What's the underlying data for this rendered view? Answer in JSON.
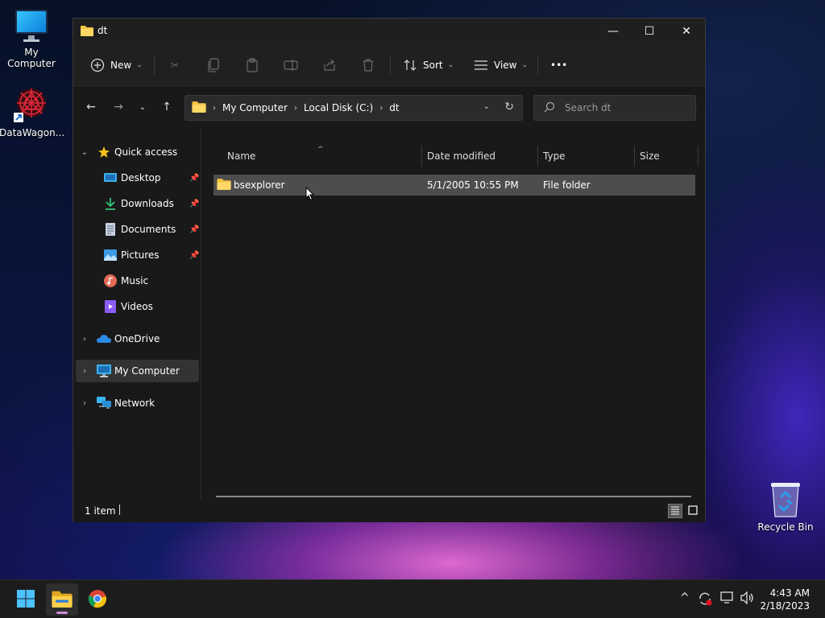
{
  "desktop": {
    "icons": [
      {
        "label": "My Computer"
      },
      {
        "label": "DataWagon..."
      },
      {
        "label": "Recycle Bin"
      }
    ]
  },
  "window": {
    "title": "dt",
    "controls": {
      "minimize": "—",
      "maximize": "☐",
      "close": "✕"
    }
  },
  "toolbar": {
    "new_label": "New",
    "sort_label": "Sort",
    "view_label": "View",
    "more_label": "•••"
  },
  "address": {
    "crumbs": [
      "My Computer",
      "Local Disk (C:)",
      "dt"
    ]
  },
  "search": {
    "placeholder": "Search dt"
  },
  "navpane": {
    "quick_access": "Quick access",
    "items": [
      {
        "label": "Desktop",
        "pinned": true
      },
      {
        "label": "Downloads",
        "pinned": true
      },
      {
        "label": "Documents",
        "pinned": true
      },
      {
        "label": "Pictures",
        "pinned": true
      },
      {
        "label": "Music",
        "pinned": false
      },
      {
        "label": "Videos",
        "pinned": false
      }
    ],
    "onedrive": "OneDrive",
    "mycomputer": "My Computer",
    "network": "Network"
  },
  "content": {
    "columns": {
      "name": "Name",
      "date": "Date modified",
      "type": "Type",
      "size": "Size"
    },
    "rows": [
      {
        "name": "bsexplorer",
        "date": "5/1/2005 10:55 PM",
        "type": "File folder",
        "size": ""
      }
    ]
  },
  "statusbar": {
    "count": "1 item"
  },
  "taskbar": {
    "clock_time": "4:43 AM",
    "clock_date": "2/18/2023"
  },
  "colors": {
    "folder": "#f4c542",
    "accent": "#60cdff",
    "window_bg": "#191919",
    "selection": "#4d4d4d"
  }
}
